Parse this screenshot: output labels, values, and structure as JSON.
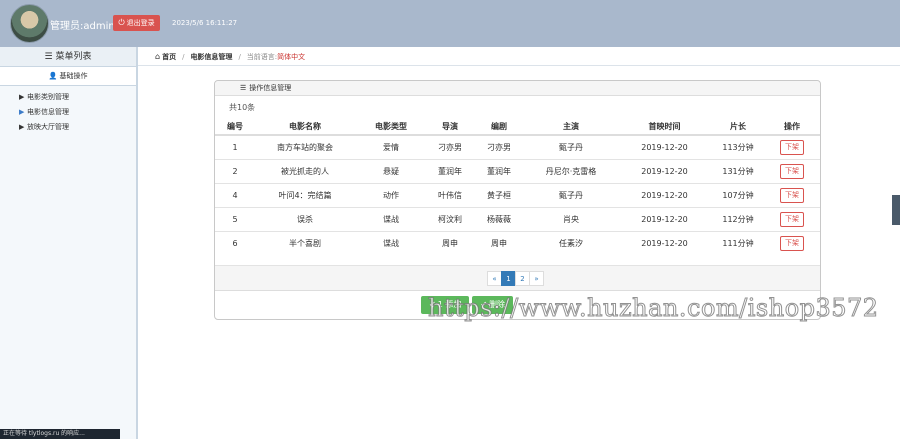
{
  "header": {
    "admin_label": "管理员:admin",
    "logout_label": "退出登录",
    "datetime": "2023/5/6 16:11:27"
  },
  "sidebar": {
    "title": "菜单列表",
    "section": "基础操作",
    "items": [
      {
        "label": "电影类别管理"
      },
      {
        "label": "电影信息管理"
      },
      {
        "label": "放映大厅管理"
      }
    ]
  },
  "breadcrumb": {
    "home": "首页",
    "current": "电影信息管理",
    "lang_prefix": "当前语言:",
    "lang": "简体中文"
  },
  "panel": {
    "title": "操作信息管理",
    "total": "共10条"
  },
  "table": {
    "columns": [
      "编号",
      "电影名称",
      "电影类型",
      "导演",
      "编剧",
      "主演",
      "首映时间",
      "片长",
      "操作"
    ],
    "rows": [
      [
        "1",
        "南方车站的聚会",
        "爱情",
        "刁亦男",
        "刁亦男",
        "甄子丹",
        "2019-12-20",
        "113分钟",
        "下架"
      ],
      [
        "2",
        "被光抓走的人",
        "悬疑",
        "董润年",
        "董润年",
        "丹尼尔·克雷格",
        "2019-12-20",
        "131分钟",
        "下架"
      ],
      [
        "4",
        "叶问4：完结篇",
        "动作",
        "叶伟信",
        "黄子桓",
        "甄子丹",
        "2019-12-20",
        "107分钟",
        "下架"
      ],
      [
        "5",
        "误杀",
        "谍战",
        "柯汶利",
        "杨薇薇",
        "肖央",
        "2019-12-20",
        "112分钟",
        "下架"
      ],
      [
        "6",
        "半个喜剧",
        "谍战",
        "周申",
        "周申",
        "任素汐",
        "2019-12-20",
        "111分钟",
        "下架"
      ]
    ]
  },
  "pager": {
    "prev": "«",
    "pages": [
      "1",
      "2"
    ],
    "current": "1",
    "next": "»"
  },
  "actions": {
    "add": "1 添加",
    "delete": "删除"
  },
  "status_bar": "正在等待 tlytlogs.ru 的响应...",
  "watermark": "https://www.huzhan.com/ishop3572",
  "colors": {
    "header_bg": "#a9b8cc",
    "logout_bg": "#d9534f",
    "primary": "#337ab7",
    "success": "#5cb85c"
  }
}
